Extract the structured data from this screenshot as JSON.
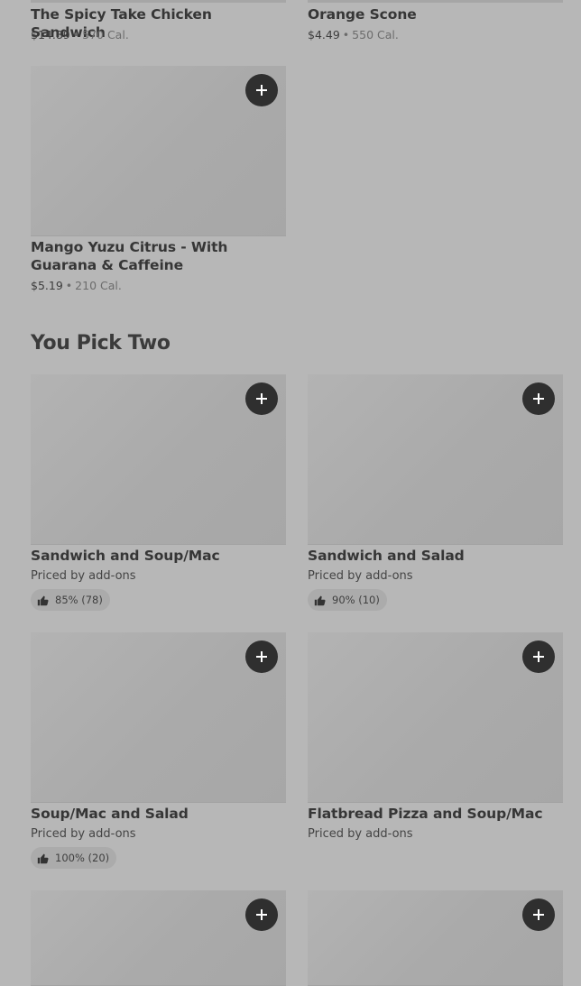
{
  "top_items": [
    {
      "name": "The Spicy Take Chicken Sandwich",
      "price": "$14.89",
      "calories": "570 Cal."
    },
    {
      "name": "Orange Scone",
      "price": "$4.49",
      "calories": "550 Cal."
    },
    {
      "name": "Mango Yuzu Citrus - With Guarana & Caffeine",
      "price": "$5.19",
      "calories": "210 Cal."
    }
  ],
  "separator": "•",
  "section": {
    "title": "You Pick Two",
    "items": [
      {
        "name": "Sandwich and Soup/Mac",
        "subtitle": "Priced by add-ons",
        "rating": "85% (78)"
      },
      {
        "name": "Sandwich and Salad",
        "subtitle": "Priced by add-ons",
        "rating": "90% (10)"
      },
      {
        "name": "Soup/Mac and Salad",
        "subtitle": "Priced by add-ons",
        "rating": "100% (20)"
      },
      {
        "name": "Flatbread Pizza and Soup/Mac",
        "subtitle": "Priced by add-ons"
      }
    ]
  },
  "icons": {
    "add": "plus-icon",
    "rating": "thumbs-up-icon"
  }
}
